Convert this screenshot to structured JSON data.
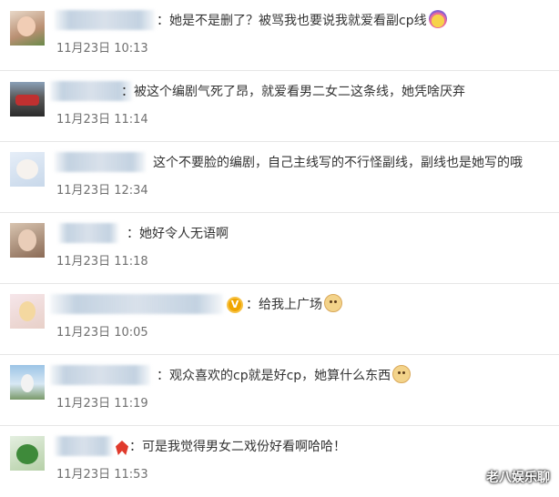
{
  "comments": [
    {
      "text": "：她是不是删了？被骂我也要说我就爱看副cp线",
      "time": "11月23日 10:13",
      "emoji": "fan-emoji"
    },
    {
      "text": "：被这个编剧气死了昂，就爱看男二女二这条线，她凭啥厌弃",
      "time": "11月23日 11:14"
    },
    {
      "text": "这个不要脸的编剧，自己主线写的不行怪副线，副线也是她写的哦",
      "time": "11月23日 12:34"
    },
    {
      "text": "：她好令人无语啊",
      "time": "11月23日 11:18"
    },
    {
      "text": "：给我上广场",
      "time": "11月23日 10:05",
      "emoji": "doge-emoji",
      "verified_icon": "verified-v-icon"
    },
    {
      "text": "：观众喜欢的cp就是好cp，她算什么东西",
      "time": "11月23日 11:19",
      "emoji": "doge-emoji"
    },
    {
      "text": "：可是我觉得男女二戏份好看啊哈哈！",
      "time": "11月23日 11:53",
      "badge_icon": "red-badge-icon"
    }
  ],
  "watermark": "老八娱乐聊"
}
